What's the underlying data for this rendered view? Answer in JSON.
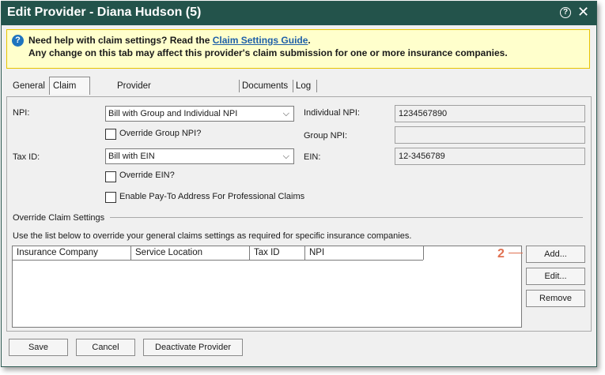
{
  "window": {
    "title": "Edit Provider - Diana Hudson (5)"
  },
  "banner": {
    "line1_prefix": "Need help with claim settings? Read the ",
    "link": "Claim Settings Guide",
    "line1_suffix": ".",
    "line2": "Any change on this tab may affect this provider's claim submission for one or more insurance companies."
  },
  "tabs": [
    "General",
    "Claim Settings",
    "Provider Performance Report",
    "Documents",
    "Log"
  ],
  "active_tab": "Claim Settings",
  "form": {
    "npi_label": "NPI:",
    "npi_value": "Bill with Group and Individual NPI",
    "override_group_npi": "Override Group NPI?",
    "tax_id_label": "Tax ID:",
    "tax_id_value": "Bill with EIN",
    "override_ein": "Override EIN?",
    "pay_to": "Enable Pay-To Address For Professional Claims",
    "individual_npi_label": "Individual NPI:",
    "individual_npi_value": "1234567890",
    "group_npi_label": "Group NPI:",
    "group_npi_value": "",
    "ein_label": "EIN:",
    "ein_value": "12-3456789"
  },
  "override": {
    "title": "Override Claim Settings",
    "description": "Use the list below to override your general claims settings as required for specific insurance companies.",
    "columns": [
      "Insurance Company",
      "Service Location",
      "Tax ID",
      "NPI"
    ],
    "buttons": {
      "add": "Add...",
      "edit": "Edit...",
      "remove": "Remove"
    },
    "callout": "2"
  },
  "footer": {
    "save": "Save",
    "cancel": "Cancel",
    "deactivate": "Deactivate Provider"
  },
  "colors": {
    "titlebar": "#23534b",
    "banner_bg": "#ffffcc",
    "link": "#1e5fa8",
    "callout": "#e07050"
  },
  "icons": {
    "help": "question-circle-icon",
    "close": "close-icon",
    "info": "info-icon",
    "dropdown": "chevron-down-icon"
  }
}
